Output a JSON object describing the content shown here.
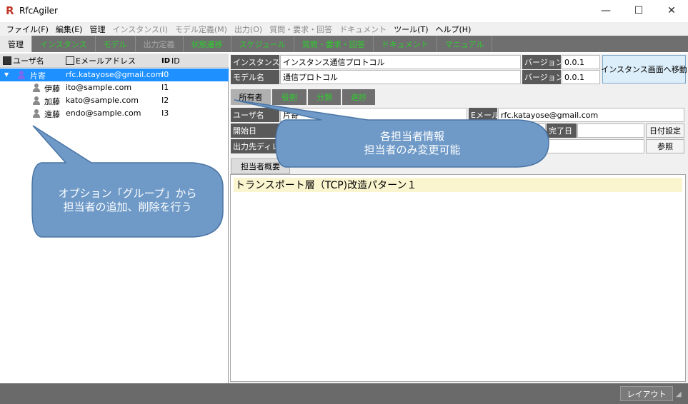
{
  "app": {
    "title": "RfcAgiler",
    "logo": "R"
  },
  "window_controls": {
    "minimize": "—",
    "maximize": "☐",
    "close": "✕"
  },
  "menu": [
    {
      "label": "ファイル(F)",
      "enabled": true
    },
    {
      "label": "編集(E)",
      "enabled": true
    },
    {
      "label": "管理",
      "enabled": true
    },
    {
      "label": "インスタンス(I)",
      "enabled": false
    },
    {
      "label": "モデル定義(M)",
      "enabled": false
    },
    {
      "label": "出力(O)",
      "enabled": false
    },
    {
      "label": "質問・要求・回答",
      "enabled": false
    },
    {
      "label": "ドキュメント",
      "enabled": false
    },
    {
      "label": "ツール(T)",
      "enabled": true
    },
    {
      "label": "ヘルプ(H)",
      "enabled": true
    }
  ],
  "top_tabs": [
    {
      "label": "管理",
      "state": "active"
    },
    {
      "label": "インスタンス",
      "state": "green"
    },
    {
      "label": "モデル",
      "state": "green"
    },
    {
      "label": "出力定義",
      "state": "disabled"
    },
    {
      "label": "状態遷移",
      "state": "green"
    },
    {
      "label": "スケジュール",
      "state": "green"
    },
    {
      "label": "質問・要求・回答",
      "state": "green"
    },
    {
      "label": "ドキュメント",
      "state": "green"
    },
    {
      "label": "マニュアル",
      "state": "green"
    }
  ],
  "user_list": {
    "columns": {
      "name": "ユーザ名",
      "email": "Eメールアドレス",
      "id": "ID"
    },
    "id_icon": "ID",
    "rows": [
      {
        "name": "片寄",
        "email": "rfc.katayose@gmail.com",
        "id": "I0",
        "selected": true
      },
      {
        "name": "伊藤",
        "email": "ito@sample.com",
        "id": "I1",
        "selected": false
      },
      {
        "name": "加藤",
        "email": "kato@sample.com",
        "id": "I2",
        "selected": false
      },
      {
        "name": "遠藤",
        "email": "endo@sample.com",
        "id": "I3",
        "selected": false
      }
    ]
  },
  "instance": {
    "instance_name_label": "インスタンス名",
    "instance_name_value": "インスタンス通信プロトコル",
    "model_name_label": "モデル名",
    "model_name_value": "通信プロトコル",
    "version_label": "バージョン",
    "instance_version": "0.0.1",
    "model_version": "0.0.1",
    "goto_button": "インスタンス画面へ移動"
  },
  "sub_tabs": [
    {
      "label": "所有者",
      "active": true
    },
    {
      "label": "役割",
      "active": false
    },
    {
      "label": "分類",
      "active": false
    },
    {
      "label": "進捗",
      "active": false
    }
  ],
  "owner": {
    "user_label": "ユーザ名",
    "user_value": "片寄",
    "email_label": "Eメール",
    "email_value": "rfc.katayose@gmail.com",
    "start_label": "開始日",
    "end_label": "完了日",
    "date_button": "日付設定",
    "outdir_label": "出力先ディレクトリ",
    "browse_button": "参照"
  },
  "summary_tab": "担当者概要",
  "summary_text": "トランスポート層（TCP)改造パターン１",
  "status": {
    "layout_button": "レイアウト"
  },
  "callouts": {
    "left": [
      "オプション「グループ」から",
      "担当者の追加、削除を行う"
    ],
    "right": [
      "各担当者情報",
      "担当者のみ変更可能"
    ],
    "color": "#6f9ac8",
    "border": "#4a74a4"
  },
  "colors": {
    "selection": "#1e90ff",
    "tab_green": "#2ecc2e",
    "tab_bar": "#6f6f6f"
  }
}
